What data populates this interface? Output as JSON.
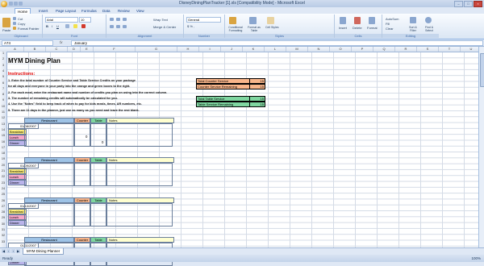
{
  "window": {
    "title": "DisneyDiningPlanTracker [1].xls  [Compatibility Mode] - Microsoft Excel"
  },
  "ribbon_tabs": [
    "Home",
    "Insert",
    "Page Layout",
    "Formulas",
    "Data",
    "Review",
    "View"
  ],
  "ribbon": {
    "clipboard": {
      "cut": "Cut",
      "copy": "Copy",
      "paste": "Paste",
      "format_painter": "Format Painter",
      "label": "Clipboard"
    },
    "font": {
      "name": "Arial",
      "size": "10",
      "label": "Font"
    },
    "alignment": {
      "wrap_text": "Wrap Text",
      "merge": "Merge & Center",
      "label": "Alignment"
    },
    "number": {
      "format": "General",
      "label": "Number"
    },
    "styles": {
      "conditional": "Conditional Formatting",
      "table": "Format as Table",
      "cell": "Cell Styles",
      "label": "Styles"
    },
    "cells": {
      "insert": "Insert",
      "delete": "Delete",
      "format": "Format",
      "label": "Cells"
    },
    "editing": {
      "autosum": "AutoSum",
      "fill": "Fill",
      "clear": "Clear",
      "sort": "Sort & Filter",
      "find": "Find & Select",
      "label": "Editing"
    }
  },
  "formula_bar": {
    "name_box": "A74",
    "fx": "fx",
    "value": "January"
  },
  "columns": [
    "A",
    "B",
    "C",
    "D",
    "E",
    "F",
    "G",
    "H",
    "I",
    "J",
    "K",
    "L",
    "M",
    "N",
    "O",
    "P",
    "Q",
    "R",
    "S",
    "T",
    "U"
  ],
  "rows": [
    "1",
    "2",
    "3",
    "4",
    "5",
    "6",
    "7",
    "8",
    "9",
    "10",
    "11",
    "12",
    "13",
    "14",
    "15",
    "16",
    "17",
    "18",
    "19",
    "20",
    "21",
    "22",
    "23",
    "24",
    "25",
    "26",
    "27",
    "28",
    "29",
    "30",
    "31",
    "32",
    "33"
  ],
  "sheet": {
    "title": "MYM Dining Plan",
    "instructions_header": "Instructions:",
    "instructions": [
      "1. Enter the total number of Counter Service and Table Service Credits on your package",
      "   for all days and everyone in your party into the orange and green boxes to the right.",
      "2. For each meal, enter the restaurant name and number of credits you plan on using into the correct column.",
      "3. The number of remaining credits will automatically be calculated for you.",
      "4. Use the \"Notes\" field to keep track of when to pay for kids meals, times, AR numbers, etc.",
      "5. There are 11 days in the planner, just use as many as you need and leave the rest blank."
    ],
    "summary": [
      {
        "label": "Total Counter Service",
        "value": "15",
        "color": "#f8b58a"
      },
      {
        "label": "Counter Service Remaining",
        "value": "15",
        "color": "#f8b58a"
      },
      {
        "label": "Total Table Service",
        "value": "15",
        "color": "#7fd6a0"
      },
      {
        "label": "Table Service Remaining",
        "value": "15",
        "color": "#7fd6a0"
      }
    ],
    "block_headers": {
      "restaurant": "Restaurant",
      "counter": "Counter",
      "table": "Table",
      "notes": "Notes"
    },
    "meals": [
      "Breakfast",
      "Lunch",
      "Dinner"
    ],
    "blocks": [
      {
        "date": "01/08/2007",
        "lunch_counter": "0",
        "dinner_table": "0"
      },
      {
        "date": "01/09/2007"
      },
      {
        "date": "01/10/2007"
      },
      {
        "date": "01/11/2007"
      }
    ]
  },
  "sheet_tab": "MYM Dining Planner",
  "status": {
    "ready": "Ready",
    "zoom": "100%"
  },
  "colors": {
    "header_blue": "#9ec3e6",
    "counter_orange": "#f8b58a",
    "table_green": "#7fd6a0",
    "breakfast_yellow": "#fff07a",
    "lunch_pink": "#f6a6c8",
    "dinner_purple": "#b9b3ea"
  }
}
